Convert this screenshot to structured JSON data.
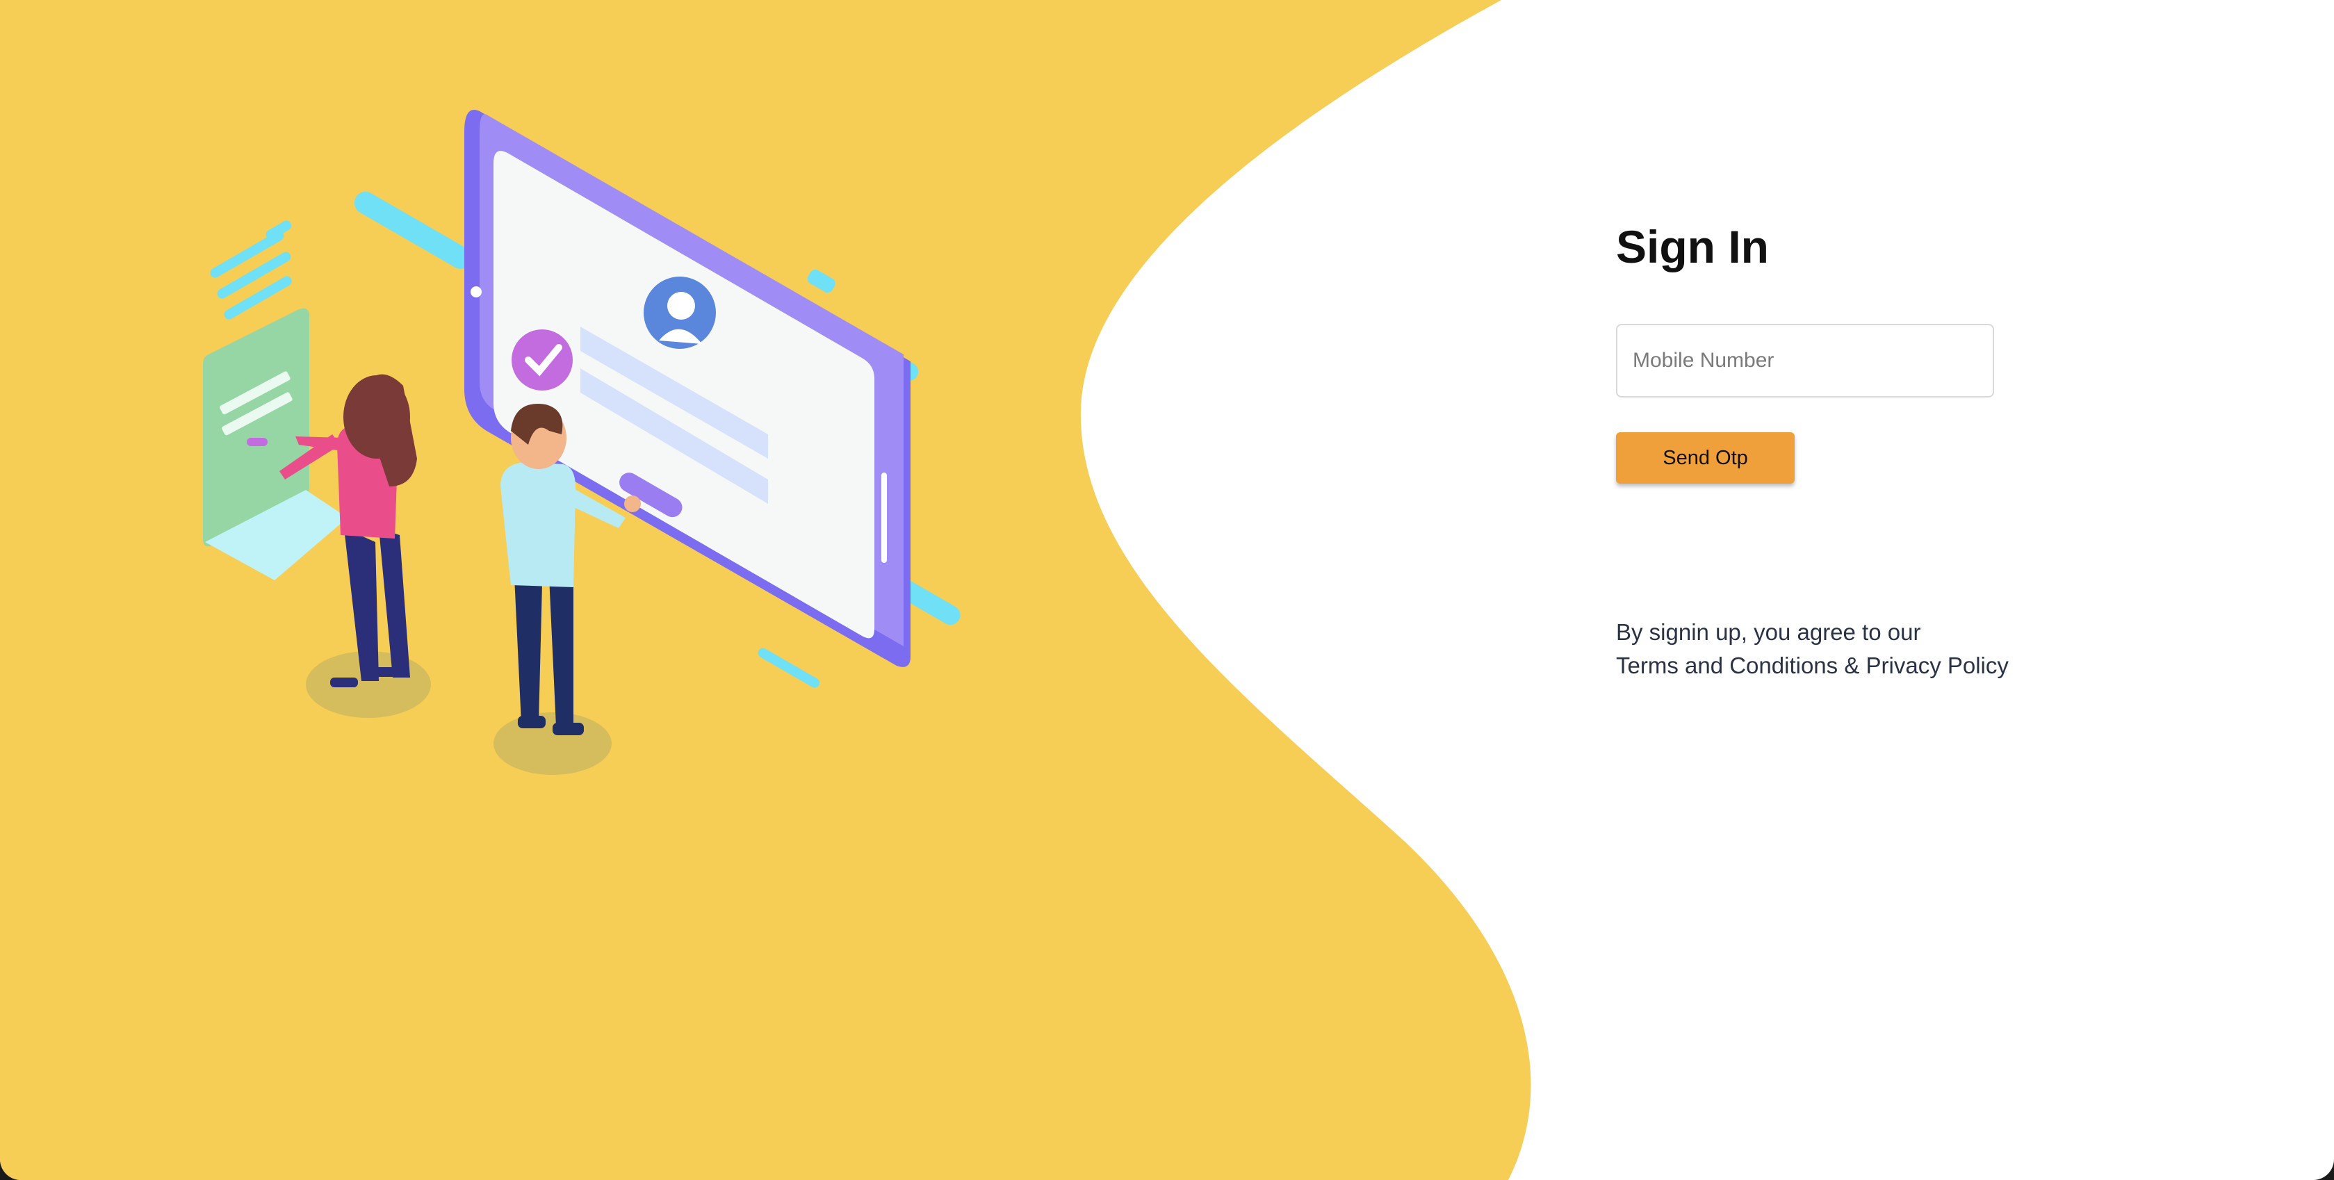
{
  "colors": {
    "wave_background": "#f6cd55",
    "page_background": "#ffffff",
    "accent_button": "#f0a03b",
    "phone_frame": "#7b6cf0",
    "cyan_accent": "#6fe0f5"
  },
  "signin": {
    "title": "Sign In",
    "mobile_placeholder": "Mobile Number",
    "mobile_value": "",
    "send_button_label": "Send Otp"
  },
  "terms": {
    "line1": "By signin up, you agree to our",
    "link_text": "Terms and Conditions & Privacy Policy"
  },
  "illustration": {
    "icons": [
      "user-avatar-icon",
      "checkmark-icon"
    ]
  }
}
